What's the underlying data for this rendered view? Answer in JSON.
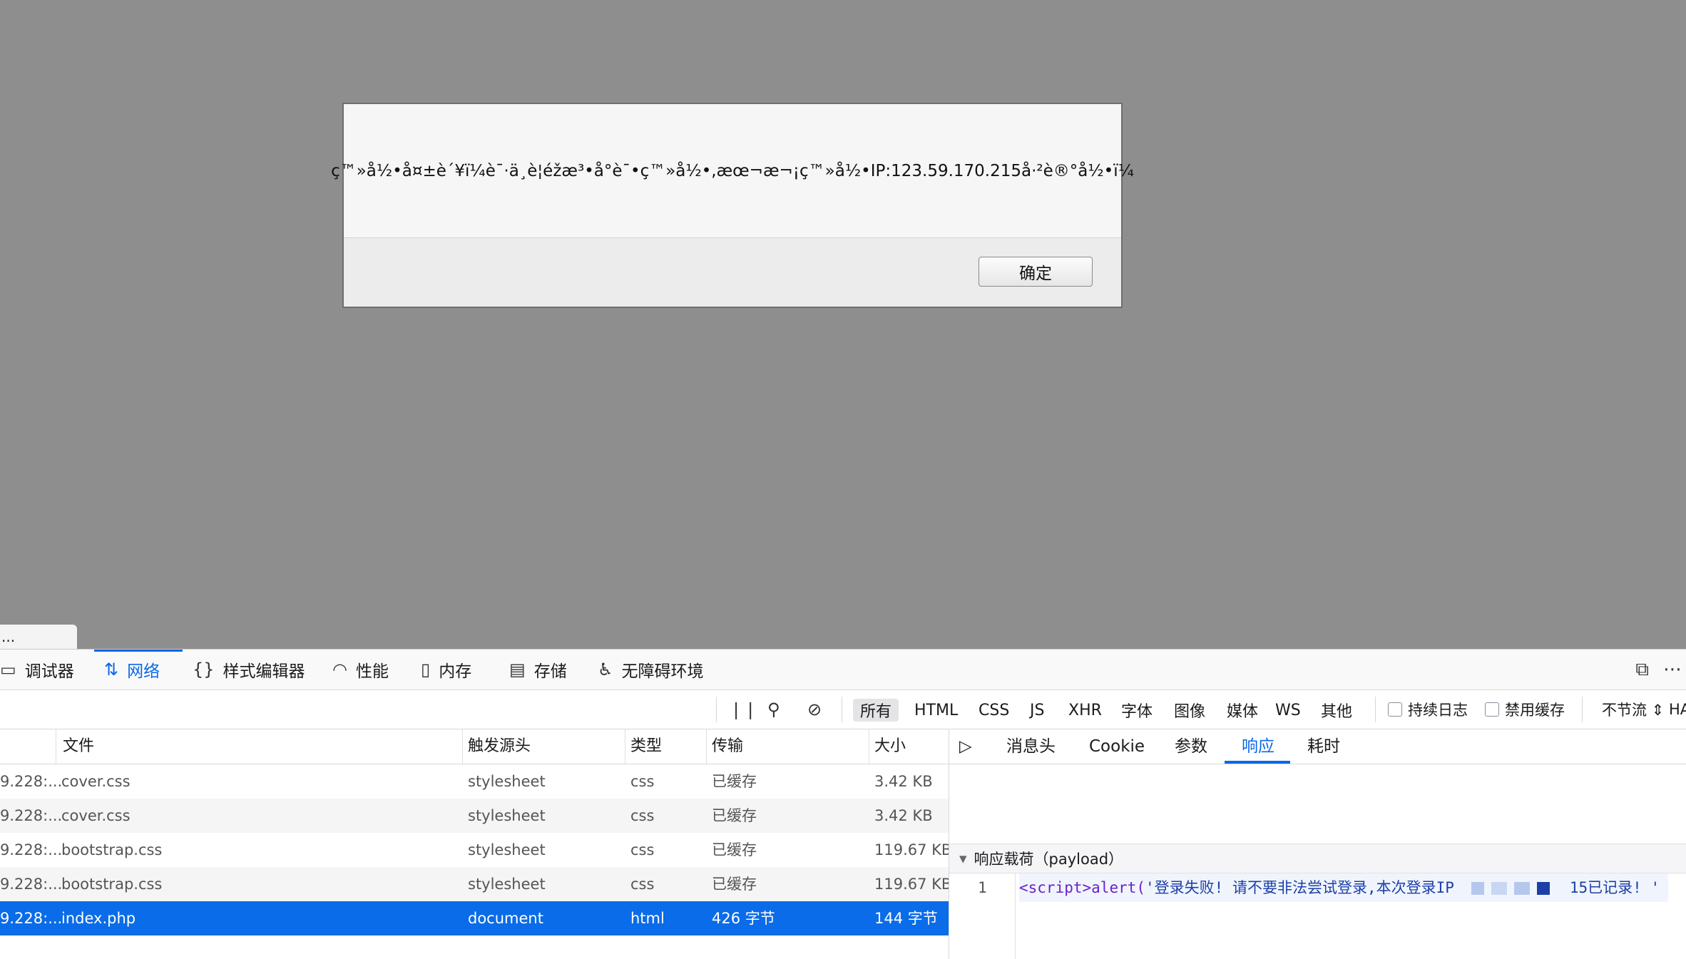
{
  "dialog": {
    "message": "ç™»å½•å¤±è´¥ï¼è¯·ä¸è¦éžæ³•å°è¯•ç™»å½•,æœ¬æ¬¡ç™»å½•IP:123.59.170.215å·²è®°å½•ï¼",
    "ok_label": "确定"
  },
  "mini_tab": {
    "label": "..."
  },
  "toolbox": {
    "tabs": [
      {
        "label": "调试器",
        "icon": "debugger-icon"
      },
      {
        "label": "网络",
        "icon": "network-icon"
      },
      {
        "label": "样式编辑器",
        "icon": "style-editor-icon"
      },
      {
        "label": "性能",
        "icon": "performance-icon"
      },
      {
        "label": "内存",
        "icon": "memory-icon"
      },
      {
        "label": "存储",
        "icon": "storage-icon"
      },
      {
        "label": "无障碍环境",
        "icon": "accessibility-icon"
      }
    ],
    "active_tab": "网络"
  },
  "filter_bar": {
    "type_filters": [
      "所有",
      "HTML",
      "CSS",
      "JS",
      "XHR",
      "字体",
      "图像",
      "媒体",
      "WS",
      "其他"
    ],
    "selected_type": "所有",
    "persist_logs_label": "持续日志",
    "disable_cache_label": "禁用缓存",
    "throttling_label": "不节流 ⇕",
    "har_label": "HA"
  },
  "table": {
    "headers": {
      "file": "文件",
      "initiator": "触发源头",
      "type": "类型",
      "transferred": "传输",
      "size": "大小"
    },
    "rows": [
      {
        "domain": "9.228:...",
        "file": "cover.css",
        "initiator": "stylesheet",
        "type": "css",
        "transferred": "已缓存",
        "size": "3.42 KB"
      },
      {
        "domain": "9.228:...",
        "file": "cover.css",
        "initiator": "stylesheet",
        "type": "css",
        "transferred": "已缓存",
        "size": "3.42 KB"
      },
      {
        "domain": "9.228:...",
        "file": "bootstrap.css",
        "initiator": "stylesheet",
        "type": "css",
        "transferred": "已缓存",
        "size": "119.67 KB"
      },
      {
        "domain": "9.228:...",
        "file": "bootstrap.css",
        "initiator": "stylesheet",
        "type": "css",
        "transferred": "已缓存",
        "size": "119.67 KB"
      },
      {
        "domain": "9.228:...",
        "file": "index.php",
        "initiator": "document",
        "type": "html",
        "transferred": "426 字节",
        "size": "144 字节"
      }
    ]
  },
  "side_panel": {
    "tabs": [
      "消息头",
      "Cookie",
      "参数",
      "响应",
      "耗时"
    ],
    "active_tab": "响应",
    "payload_title": "响应载荷（payload）",
    "line_number": "1",
    "code_tag": "<script>",
    "code_fn": "alert(",
    "code_string": "'登录失败! 请不要非法尝试登录,本次登录IP",
    "code_tail": "15已记录! '"
  }
}
